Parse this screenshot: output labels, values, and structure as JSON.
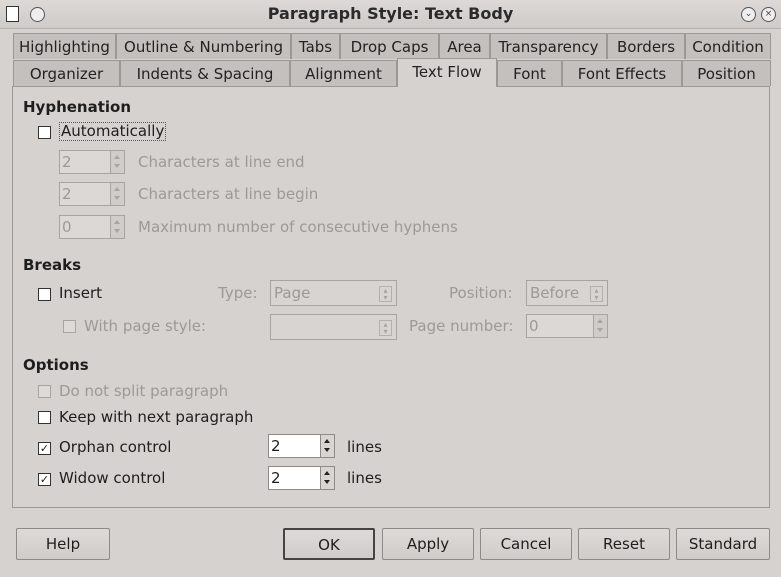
{
  "window": {
    "title": "Paragraph Style: Text Body"
  },
  "tabs_row1": [
    "Highlighting",
    "Outline & Numbering",
    "Tabs",
    "Drop Caps",
    "Area",
    "Transparency",
    "Borders",
    "Condition"
  ],
  "tabs_row2": [
    "Organizer",
    "Indents & Spacing",
    "Alignment",
    "Text Flow",
    "Font",
    "Font Effects",
    "Position"
  ],
  "active_tab": "Text Flow",
  "hyphenation": {
    "heading": "Hyphenation",
    "automatically": {
      "label": "Automatically",
      "checked": false
    },
    "chars_line_end": {
      "value": "2",
      "label": "Characters at line end"
    },
    "chars_line_begin": {
      "value": "2",
      "label": "Characters at line begin"
    },
    "max_hyphens": {
      "value": "0",
      "label": "Maximum number of consecutive hyphens"
    }
  },
  "breaks": {
    "heading": "Breaks",
    "insert": {
      "label": "Insert",
      "checked": false
    },
    "type_label": "Type:",
    "type_value": "Page",
    "position_label": "Position:",
    "position_value": "Before",
    "with_page_style": {
      "label": "With page style:",
      "checked": false
    },
    "page_style_value": "",
    "page_number_label": "Page number:",
    "page_number_value": "0"
  },
  "options": {
    "heading": "Options",
    "do_not_split": {
      "label": "Do not split paragraph",
      "checked": false
    },
    "keep_with_next": {
      "label": "Keep with next paragraph",
      "checked": false
    },
    "orphan": {
      "label": "Orphan control",
      "checked": true,
      "value": "2",
      "unit": "lines"
    },
    "widow": {
      "label": "Widow control",
      "checked": true,
      "value": "2",
      "unit": "lines"
    }
  },
  "buttons": {
    "help": "Help",
    "ok": "OK",
    "apply": "Apply",
    "cancel": "Cancel",
    "reset": "Reset",
    "standard": "Standard"
  },
  "check_glyph": "✓"
}
